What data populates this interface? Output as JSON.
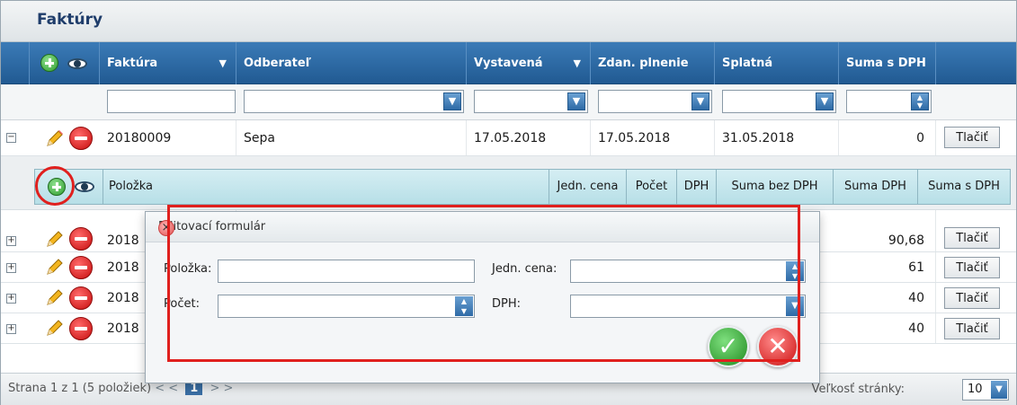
{
  "grid": {
    "title": "Faktúry",
    "columns": [
      {
        "label": "Faktúra",
        "sort": "▼"
      },
      {
        "label": "Odberateľ",
        "sort": ""
      },
      {
        "label": "Vystavená",
        "sort": "▼"
      },
      {
        "label": "Zdan. plnenie",
        "sort": ""
      },
      {
        "label": "Splatná",
        "sort": ""
      },
      {
        "label": "Suma s DPH",
        "sort": ""
      }
    ],
    "rows": [
      {
        "faktura": "20180009",
        "odberatel": "Sepa",
        "vystavena": "17.05.2018",
        "zdan": "17.05.2018",
        "splatna": "31.05.2018",
        "suma": "0",
        "expanded": true
      },
      {
        "faktura": "2018",
        "suma": "90,68"
      },
      {
        "faktura": "2018",
        "suma": "61"
      },
      {
        "faktura": "2018",
        "suma": "40"
      },
      {
        "faktura": "2018",
        "suma": "40"
      }
    ],
    "print_label": "Tlačiť"
  },
  "detail": {
    "columns": [
      "Položka",
      "Jedn. cena",
      "Počet",
      "DPH",
      "Suma bez DPH",
      "Suma DPH",
      "Suma s DPH"
    ]
  },
  "popup": {
    "title": "Editovací formulár",
    "fields": {
      "polozka": "Položka:",
      "jedn_cena": "Jedn. cena:",
      "pocet": "Počet:",
      "dph": "DPH:"
    }
  },
  "footer": {
    "page_info": "Strana 1 z 1 (5 položiek)",
    "prev": "< <",
    "current_page": "1",
    "next": "> >",
    "page_size_label": "Veľkosť stránky:",
    "page_size": "10"
  },
  "colors": {
    "header_blue": "#2f6aa5",
    "highlight_red": "#e0201e",
    "detail_header": "#c5e6ed"
  }
}
